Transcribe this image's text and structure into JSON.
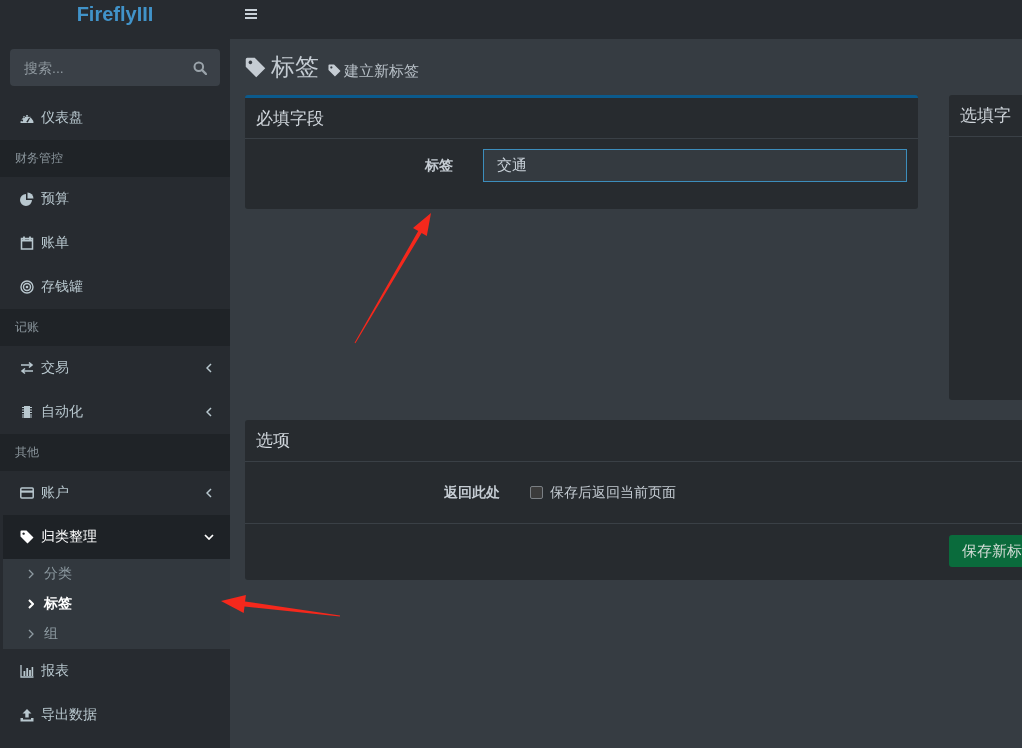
{
  "logo": "FireflyIII",
  "sidebar": {
    "search": {
      "placeholder": "搜索..."
    },
    "items": [
      {
        "kind": "link",
        "label": "仪表盘",
        "selected": false
      },
      {
        "kind": "header",
        "label": "财务管控"
      },
      {
        "kind": "link",
        "label": "预算",
        "selected": false
      },
      {
        "kind": "link",
        "label": "账单",
        "selected": false
      },
      {
        "kind": "link",
        "label": "存钱罐",
        "selected": false
      },
      {
        "kind": "header",
        "label": "记账"
      },
      {
        "kind": "group",
        "label": "交易",
        "selected": false,
        "expanded": false
      },
      {
        "kind": "group",
        "label": "自动化",
        "selected": false,
        "expanded": false
      },
      {
        "kind": "header",
        "label": "其他"
      },
      {
        "kind": "group",
        "label": "账户",
        "selected": false,
        "expanded": false
      },
      {
        "kind": "group",
        "label": "归类整理",
        "selected": true,
        "expanded": true,
        "children": [
          {
            "label": "分类",
            "selected": false
          },
          {
            "label": "标签",
            "selected": true
          },
          {
            "label": "组",
            "selected": false
          }
        ]
      },
      {
        "kind": "link",
        "label": "报表",
        "selected": false
      },
      {
        "kind": "link",
        "label": "导出数据",
        "selected": false
      }
    ]
  },
  "page_header": {
    "title": "标签",
    "subtitle": "建立新标签"
  },
  "required_card": {
    "title": "必填字段",
    "fields": [
      {
        "label": "标签",
        "value": "交通",
        "focused": true
      }
    ]
  },
  "optional_card": {
    "title": "选填字"
  },
  "options_card": {
    "title": "选项",
    "options": [
      {
        "label": "返回此处",
        "text": "保存后返回当前页面",
        "checked": false
      }
    ],
    "submit": "保存新标"
  }
}
